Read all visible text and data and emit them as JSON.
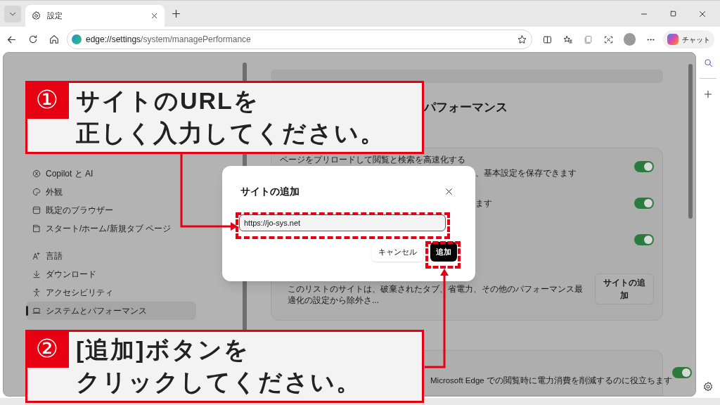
{
  "browser": {
    "tab_title": "設定",
    "address_host": "edge://settings",
    "address_path": "/system/managePerformance",
    "copilot_label": "チャット"
  },
  "sidebar": {
    "groups": [
      [
        {
          "label": "Copilot と AI",
          "selected": false
        },
        {
          "label": "外観",
          "selected": false
        },
        {
          "label": "既定のブラウザー",
          "selected": false
        },
        {
          "label": "スタート/ホーム/新規タブ ページ",
          "selected": false
        }
      ],
      [
        {
          "label": "言語",
          "selected": false
        },
        {
          "label": "ダウンロード",
          "selected": false
        },
        {
          "label": "アクセシビリティ",
          "selected": false
        },
        {
          "label": "システムとパフォーマンス",
          "selected": true
        }
      ]
    ]
  },
  "page": {
    "heading": "パフォーマンス",
    "rows": [
      {
        "kind": "toggle",
        "title": "ページをプリロードして閲覧と検索を高速化する",
        "subtitle": "、基本設定を保存できます",
        "on": true
      },
      {
        "kind": "toggle",
        "subtitle": "ます",
        "on": true
      },
      {
        "kind": "toggle",
        "on": true
      },
      {
        "kind": "button",
        "subtitle": "このリストのサイトは、破棄されたタブ、省電力、その他のパフォーマンス最適化の設定から除外さ...",
        "button": "サイトの追加"
      }
    ],
    "power_row": {
      "subtitle": "Microsoft Edge での閲覧時に電力消費を削減するのに役立ちます",
      "on": true
    }
  },
  "dialog": {
    "title": "サイトの追加",
    "input_value": "https://jo-sys.net",
    "cancel": "キャンセル",
    "confirm": "追加"
  },
  "callouts": [
    {
      "number": "①",
      "lines": [
        "サイトのURLを",
        "正しく入力してください。"
      ]
    },
    {
      "number": "②",
      "lines": [
        "[追加]ボタンを",
        "クリックしてください。"
      ]
    }
  ]
}
